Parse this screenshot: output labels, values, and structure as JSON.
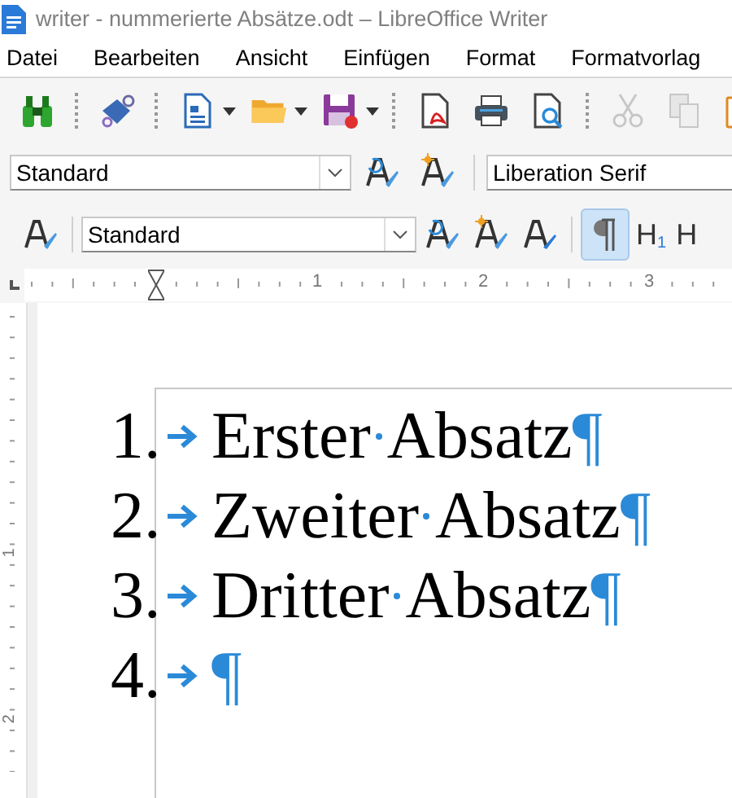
{
  "window": {
    "title": "writer - nummerierte Absätze.odt – LibreOffice Writer"
  },
  "menu": [
    {
      "label": "Datei"
    },
    {
      "label": "Bearbeiten"
    },
    {
      "label": "Ansicht"
    },
    {
      "label": "Einfügen"
    },
    {
      "label": "Format"
    },
    {
      "label": "Formatvorlag"
    }
  ],
  "toolbar_standard": [
    {
      "kind": "binoculars",
      "disabled": false
    },
    {
      "kind": "sep"
    },
    {
      "kind": "stamp",
      "disabled": false
    },
    {
      "kind": "sep"
    },
    {
      "kind": "new",
      "disabled": false
    },
    {
      "kind": "drop"
    },
    {
      "kind": "folder",
      "disabled": false
    },
    {
      "kind": "drop"
    },
    {
      "kind": "save",
      "disabled": false
    },
    {
      "kind": "drop"
    },
    {
      "kind": "sep"
    },
    {
      "kind": "pdf",
      "disabled": false
    },
    {
      "kind": "print",
      "disabled": false
    },
    {
      "kind": "preview",
      "disabled": false
    },
    {
      "kind": "sep"
    },
    {
      "kind": "cut",
      "disabled": true
    },
    {
      "kind": "copy",
      "disabled": true
    },
    {
      "kind": "paste",
      "disabled": false
    }
  ],
  "toolbar_font": {
    "style_box": {
      "value": "Standard"
    },
    "font_box": {
      "value": "Liberation Serif"
    }
  },
  "toolbar_paragraph": {
    "style_box": {
      "value": "Standard"
    },
    "formatting_marks": {
      "selected": true
    },
    "heading_buttons": [
      {
        "label": "H",
        "sub": "1"
      },
      {
        "label": "H"
      }
    ]
  },
  "ruler": {
    "marks": [
      "1",
      "2",
      "3"
    ]
  },
  "vertical_ruler": {
    "marks": [
      "1",
      "2"
    ]
  },
  "document": {
    "paragraphs": [
      {
        "number": "1.",
        "words": [
          "Erster",
          "Absatz"
        ],
        "pilcrow": "¶"
      },
      {
        "number": "2.",
        "words": [
          "Zweiter",
          "Absatz"
        ],
        "pilcrow": "¶"
      },
      {
        "number": "3.",
        "words": [
          "Dritter",
          "Absatz"
        ],
        "pilcrow": "¶"
      },
      {
        "number": "4.",
        "pilcrow": "¶"
      }
    ]
  }
}
